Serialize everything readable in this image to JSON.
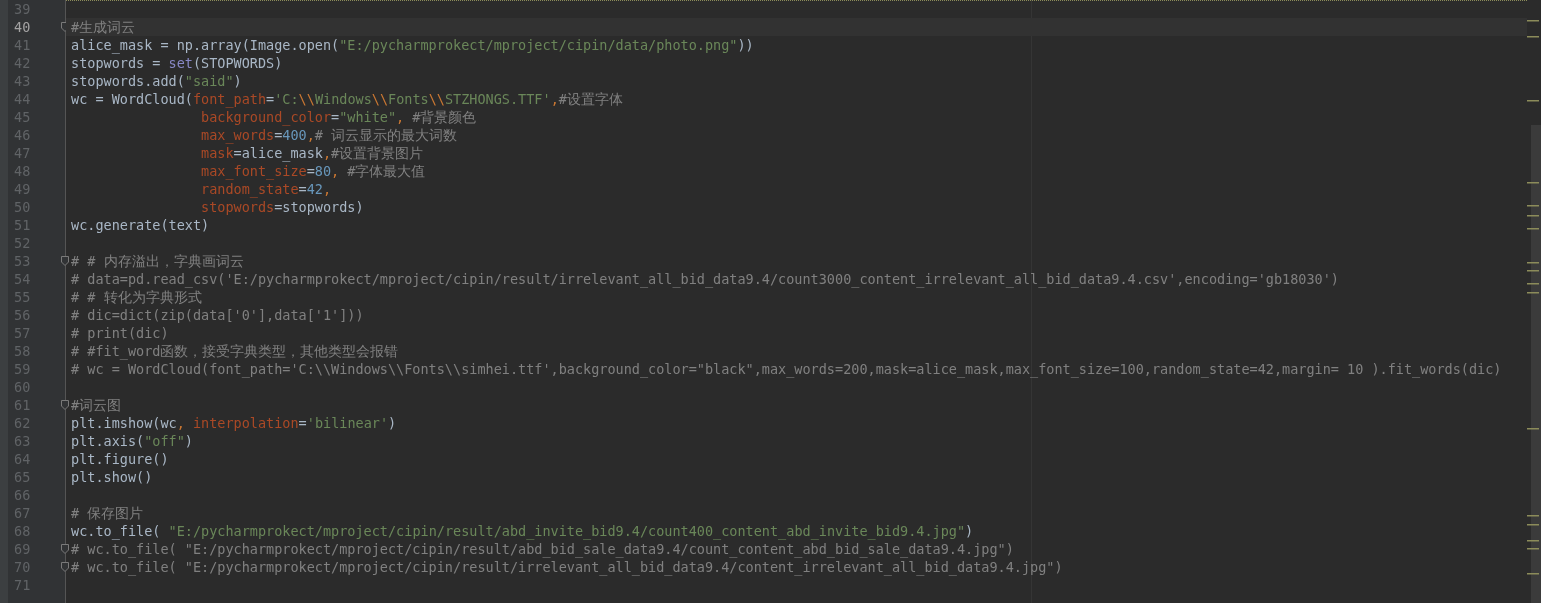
{
  "editor": {
    "lines": [
      {
        "number": "39",
        "current": false,
        "fold": false,
        "indented": false
      },
      {
        "number": "40",
        "current": true,
        "fold": true,
        "indented": false,
        "tokens": [
          {
            "text": "#生成词云",
            "kind": "comment"
          }
        ]
      },
      {
        "number": "41",
        "current": false,
        "fold": false,
        "indented": false,
        "tokens": [
          {
            "text": "alice_mask = np.array(Image.open(",
            "kind": "plain"
          },
          {
            "text": "\"E:/pycharmprokect/mproject/cipin/data/photo.png\"",
            "kind": "string"
          },
          {
            "text": "))",
            "kind": "plain"
          }
        ]
      },
      {
        "number": "42",
        "current": false,
        "fold": false,
        "indented": false,
        "tokens": [
          {
            "text": "stopwords = ",
            "kind": "plain"
          },
          {
            "text": "set",
            "kind": "builtin"
          },
          {
            "text": "(STOPWORDS)",
            "kind": "plain"
          }
        ]
      },
      {
        "number": "43",
        "current": false,
        "fold": false,
        "indented": false,
        "tokens": [
          {
            "text": "stopwords.add(",
            "kind": "plain"
          },
          {
            "text": "\"said\"",
            "kind": "string"
          },
          {
            "text": ")",
            "kind": "plain"
          }
        ]
      },
      {
        "number": "44",
        "current": false,
        "fold": false,
        "indented": false,
        "tokens": [
          {
            "text": "wc = WordCloud(",
            "kind": "plain"
          },
          {
            "text": "font_path",
            "kind": "kwarg"
          },
          {
            "text": "=",
            "kind": "plain"
          },
          {
            "text": "'C:",
            "kind": "string"
          },
          {
            "text": "\\\\",
            "kind": "escape"
          },
          {
            "text": "Windows",
            "kind": "string"
          },
          {
            "text": "\\\\",
            "kind": "escape"
          },
          {
            "text": "Fonts",
            "kind": "string"
          },
          {
            "text": "\\\\",
            "kind": "escape"
          },
          {
            "text": "STZHONGS.TTF'",
            "kind": "string"
          },
          {
            "text": ",",
            "kind": "escape"
          },
          {
            "text": "#设置字体",
            "kind": "comment"
          }
        ]
      },
      {
        "number": "45",
        "current": false,
        "fold": false,
        "indented": true,
        "tokens": [
          {
            "text": "background_color",
            "kind": "kwarg"
          },
          {
            "text": "=",
            "kind": "plain"
          },
          {
            "text": "\"white\"",
            "kind": "string"
          },
          {
            "text": ", ",
            "kind": "escape"
          },
          {
            "text": "#背景颜色",
            "kind": "comment"
          }
        ]
      },
      {
        "number": "46",
        "current": false,
        "fold": false,
        "indented": true,
        "tokens": [
          {
            "text": "max_words",
            "kind": "kwarg"
          },
          {
            "text": "=",
            "kind": "plain"
          },
          {
            "text": "400",
            "kind": "number"
          },
          {
            "text": ",",
            "kind": "escape"
          },
          {
            "text": "# 词云显示的最大词数",
            "kind": "comment"
          }
        ]
      },
      {
        "number": "47",
        "current": false,
        "fold": false,
        "indented": true,
        "tokens": [
          {
            "text": "mask",
            "kind": "kwarg"
          },
          {
            "text": "=alice_mask",
            "kind": "plain"
          },
          {
            "text": ",",
            "kind": "escape"
          },
          {
            "text": "#设置背景图片",
            "kind": "comment"
          }
        ]
      },
      {
        "number": "48",
        "current": false,
        "fold": false,
        "indented": true,
        "tokens": [
          {
            "text": "max_font_size",
            "kind": "kwarg"
          },
          {
            "text": "=",
            "kind": "plain"
          },
          {
            "text": "80",
            "kind": "number"
          },
          {
            "text": ", ",
            "kind": "escape"
          },
          {
            "text": "#字体最大值",
            "kind": "comment"
          }
        ]
      },
      {
        "number": "49",
        "current": false,
        "fold": false,
        "indented": true,
        "tokens": [
          {
            "text": "random_state",
            "kind": "kwarg"
          },
          {
            "text": "=",
            "kind": "plain"
          },
          {
            "text": "42",
            "kind": "number"
          },
          {
            "text": ",",
            "kind": "escape"
          }
        ]
      },
      {
        "number": "50",
        "current": false,
        "fold": false,
        "indented": true,
        "tokens": [
          {
            "text": "stopwords",
            "kind": "kwarg"
          },
          {
            "text": "=stopwords)",
            "kind": "plain"
          }
        ]
      },
      {
        "number": "51",
        "current": false,
        "fold": false,
        "indented": false,
        "tokens": [
          {
            "text": "wc.generate(text)",
            "kind": "plain"
          }
        ]
      },
      {
        "number": "52",
        "current": false,
        "fold": false,
        "indented": false
      },
      {
        "number": "53",
        "current": false,
        "fold": true,
        "indented": false,
        "tokens": [
          {
            "text": "# # 内存溢出，字典画词云",
            "kind": "comment"
          }
        ]
      },
      {
        "number": "54",
        "current": false,
        "fold": false,
        "indented": false,
        "tokens": [
          {
            "text": "# data=pd.read_csv('E:/pycharmprokect/mproject/cipin/result/irrelevant_all_bid_data9.4/count3000_content_irrelevant_all_bid_data9.4.csv',encoding='gb18030')",
            "kind": "comment"
          }
        ]
      },
      {
        "number": "55",
        "current": false,
        "fold": false,
        "indented": false,
        "tokens": [
          {
            "text": "# # 转化为字典形式",
            "kind": "comment"
          }
        ]
      },
      {
        "number": "56",
        "current": false,
        "fold": false,
        "indented": false,
        "tokens": [
          {
            "text": "# dic=dict(zip(data['0'],data['1']))",
            "kind": "comment"
          }
        ]
      },
      {
        "number": "57",
        "current": false,
        "fold": false,
        "indented": false,
        "tokens": [
          {
            "text": "# print(dic)",
            "kind": "comment"
          }
        ]
      },
      {
        "number": "58",
        "current": false,
        "fold": false,
        "indented": false,
        "tokens": [
          {
            "text": "# #fit_word函数，接受字典类型，其他类型会报错",
            "kind": "comment"
          }
        ]
      },
      {
        "number": "59",
        "current": false,
        "fold": false,
        "indented": false,
        "tokens": [
          {
            "text": "# wc = WordCloud(font_path='C:\\\\Windows\\\\Fonts\\\\simhei.ttf',background_color=\"black\",max_words=200,mask=alice_mask,max_font_size=100,random_state=42,margin= 10 ).fit_words(dic)",
            "kind": "comment"
          }
        ]
      },
      {
        "number": "60",
        "current": false,
        "fold": false,
        "indented": false
      },
      {
        "number": "61",
        "current": false,
        "fold": true,
        "indented": false,
        "tokens": [
          {
            "text": "#词云图",
            "kind": "comment"
          }
        ]
      },
      {
        "number": "62",
        "current": false,
        "fold": false,
        "indented": false,
        "tokens": [
          {
            "text": "plt.imshow(wc",
            "kind": "plain"
          },
          {
            "text": ", ",
            "kind": "escape"
          },
          {
            "text": "interpolation",
            "kind": "kwarg"
          },
          {
            "text": "=",
            "kind": "plain"
          },
          {
            "text": "'bilinear'",
            "kind": "string"
          },
          {
            "text": ")",
            "kind": "plain"
          }
        ]
      },
      {
        "number": "63",
        "current": false,
        "fold": false,
        "indented": false,
        "tokens": [
          {
            "text": "plt.axis(",
            "kind": "plain"
          },
          {
            "text": "\"off\"",
            "kind": "string"
          },
          {
            "text": ")",
            "kind": "plain"
          }
        ]
      },
      {
        "number": "64",
        "current": false,
        "fold": false,
        "indented": false,
        "tokens": [
          {
            "text": "plt.figure()",
            "kind": "plain"
          }
        ]
      },
      {
        "number": "65",
        "current": false,
        "fold": false,
        "indented": false,
        "tokens": [
          {
            "text": "plt.show()",
            "kind": "plain"
          }
        ]
      },
      {
        "number": "66",
        "current": false,
        "fold": false,
        "indented": false
      },
      {
        "number": "67",
        "current": false,
        "fold": false,
        "indented": false,
        "tokens": [
          {
            "text": "# 保存图片",
            "kind": "comment"
          }
        ]
      },
      {
        "number": "68",
        "current": false,
        "fold": false,
        "indented": false,
        "tokens": [
          {
            "text": "wc.to_file( ",
            "kind": "plain"
          },
          {
            "text": "\"E:/pycharmprokect/mproject/cipin/result/abd_invite_bid9.4/count400_content_abd_invite_bid9.4.jpg\"",
            "kind": "string"
          },
          {
            "text": ")",
            "kind": "plain"
          }
        ]
      },
      {
        "number": "69",
        "current": false,
        "fold": true,
        "indented": false,
        "tokens": [
          {
            "text": "# wc.to_file( \"E:/pycharmprokect/mproject/cipin/result/abd_bid_sale_data9.4/count_content_abd_bid_sale_data9.4.jpg\")",
            "kind": "comment"
          }
        ]
      },
      {
        "number": "70",
        "current": false,
        "fold": true,
        "indented": false,
        "tokens": [
          {
            "text": "# wc.to_file( \"E:/pycharmprokect/mproject/cipin/result/irrelevant_all_bid_data9.4/content_irrelevant_all_bid_data9.4.jpg\")",
            "kind": "comment"
          }
        ]
      },
      {
        "number": "71",
        "current": false,
        "fold": false,
        "indented": false
      }
    ]
  }
}
